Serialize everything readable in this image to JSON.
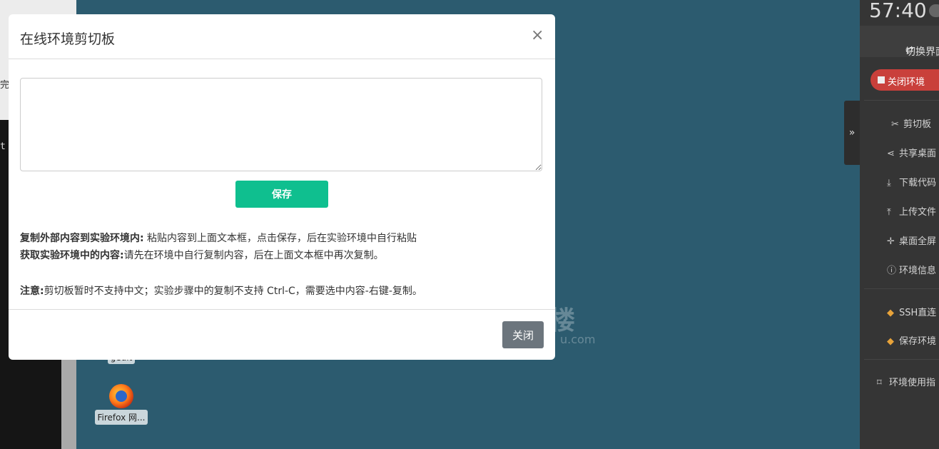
{
  "background": {
    "left_fragment_1": "完",
    "left_fragment_2": "t",
    "watermark_main": "楼",
    "watermark_sub": "u.com",
    "icons": [
      {
        "label": "gedit"
      },
      {
        "label": "Firefox 网..."
      }
    ]
  },
  "sidebar": {
    "timer": "57:40",
    "switch_label": "切换界面",
    "close_env_label": "关闭环境",
    "toggle_glyph": "»",
    "items": [
      {
        "label": "剪切板",
        "icon": "scissors-icon",
        "glyph": "✂"
      },
      {
        "label": "共享桌面",
        "icon": "share-icon",
        "glyph": "⋖"
      },
      {
        "label": "下载代码",
        "icon": "download-icon",
        "glyph": "⤓"
      },
      {
        "label": "上传文件",
        "icon": "upload-icon",
        "glyph": "⤒"
      },
      {
        "label": "桌面全屏",
        "icon": "fullscreen-icon",
        "glyph": "✛"
      },
      {
        "label": "环境信息",
        "icon": "info-icon",
        "glyph": "ⓘ"
      },
      {
        "label": "SSH直连",
        "icon": "gem-icon",
        "glyph": "◆"
      },
      {
        "label": "保存环境",
        "icon": "gem-icon",
        "glyph": "◆"
      },
      {
        "label": "环境使用指",
        "icon": "bookmark-icon",
        "glyph": "⌑"
      }
    ]
  },
  "modal": {
    "title": "在线环境剪切板",
    "close_glyph": "×",
    "textarea_value": "",
    "save_label": "保存",
    "help_1_bold": "复制外部内容到实验环境内:",
    "help_1_text": "  粘贴内容到上面文本框，点击保存，后在实验环境中自行粘贴",
    "help_2_bold": "获取实验环境中的内容:",
    "help_2_text": "请先在环境中自行复制内容，后在上面文本框中再次复制。",
    "note_bold": "注意:",
    "note_text": "剪切板暂时不支持中文；实验步骤中的复制不支持 Ctrl-C，需要选中内容-右键-复制。",
    "close_label": "关闭"
  },
  "colors": {
    "save_button": "#0fbf8f",
    "close_button": "#6c757d",
    "close_env": "#c9403b",
    "desktop": "#2c5b6f"
  }
}
